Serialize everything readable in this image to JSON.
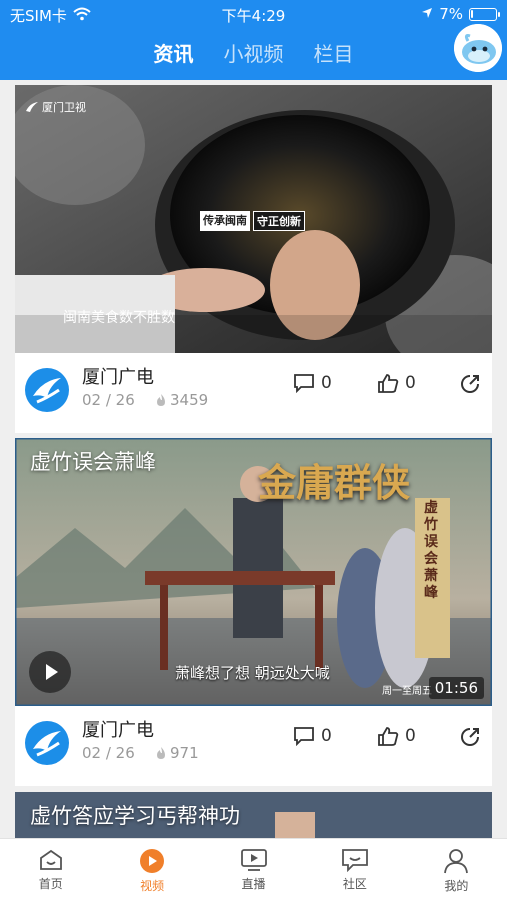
{
  "status_bar": {
    "carrier": "无SIM卡",
    "time": "下午4:29",
    "battery": "7%",
    "battery_level": 0.07
  },
  "header": {
    "tabs": [
      {
        "label": "资讯",
        "active": true
      },
      {
        "label": "小视频",
        "active": false
      },
      {
        "label": "栏目",
        "active": false
      }
    ],
    "accent": "#1f8cf0"
  },
  "feed": [
    {
      "channel_watermark": "厦门卫视",
      "video_title": "",
      "overlay_badge": [
        "传承闽南",
        "守正创新"
      ],
      "subtitle": "闽南美食数不胜数",
      "source": "厦门广电",
      "date": "02 / 26",
      "views": "3459",
      "comments": "0",
      "likes": "0"
    },
    {
      "video_title": "虚竹误会萧峰",
      "banner_text": "金庸群侠",
      "side_text": "虚竹误会萧峰",
      "subtitle": "萧峰想了想  朝远处大喊",
      "schedule": "周一至周五",
      "duration": "01:56",
      "source": "厦门广电",
      "date": "02 / 26",
      "views": "971",
      "comments": "0",
      "likes": "0"
    },
    {
      "video_title": "虚竹答应学习丐帮神功"
    }
  ],
  "bottom_nav": [
    {
      "label": "首页",
      "icon": "home-icon",
      "active": false
    },
    {
      "label": "视频",
      "icon": "video-play-icon",
      "active": true
    },
    {
      "label": "直播",
      "icon": "tv-icon",
      "active": false
    },
    {
      "label": "社区",
      "icon": "chat-icon",
      "active": false
    },
    {
      "label": "我的",
      "icon": "user-icon",
      "active": false
    }
  ],
  "colors": {
    "active_nav": "#f07f2a",
    "brand_blue": "#1c8ee8"
  }
}
